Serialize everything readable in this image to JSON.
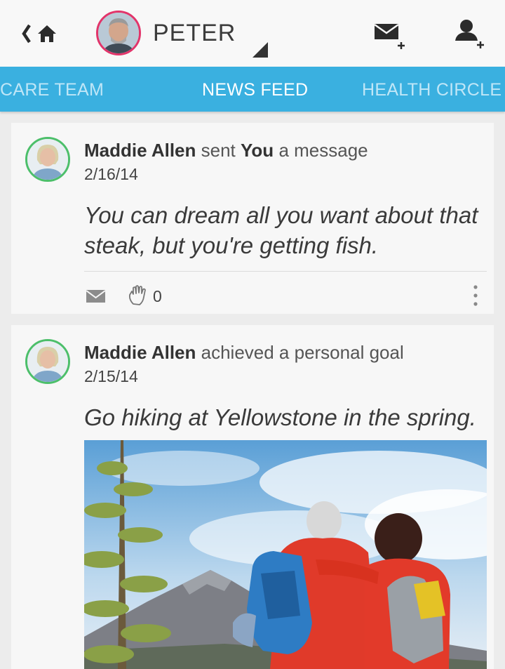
{
  "header": {
    "profile_name": "PETER",
    "icons": {
      "back": "chevron-left-icon",
      "home": "home-icon",
      "dropdown": "dropdown-triangle-icon",
      "compose": "mail-plus-icon",
      "add_user": "user-plus-icon"
    }
  },
  "tabs": [
    {
      "label": "CARE TEAM",
      "active": false
    },
    {
      "label": "NEWS FEED",
      "active": true
    },
    {
      "label": "HEALTH CIRCLE",
      "active": false
    }
  ],
  "feed": [
    {
      "author": "Maddie Allen",
      "verb": "sent",
      "target": "You",
      "tail": "a message",
      "date": "2/16/14",
      "text": "You can dream all you want about that steak, but you're getting fish.",
      "wave_count": "0"
    },
    {
      "author": "Maddie Allen",
      "action": "achieved a personal goal",
      "date": "2/15/14",
      "text": "Go hiking at Yellowstone in the spring."
    }
  ],
  "colors": {
    "tab_bar": "#3ab0e0",
    "profile_ring": "#e2346a",
    "author_ring": "#4cbf6a"
  }
}
